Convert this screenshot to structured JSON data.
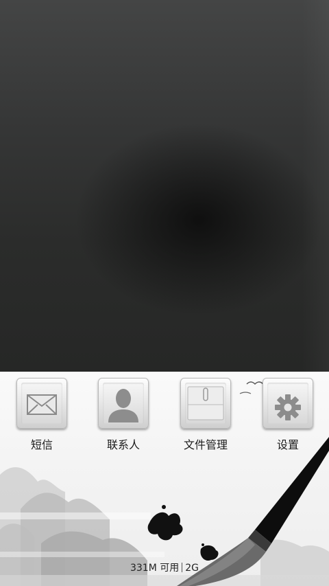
{
  "apps": [
    {
      "id": "sms",
      "label": "短信",
      "icon": "envelope-icon"
    },
    {
      "id": "contacts",
      "label": "联系人",
      "icon": "person-silhouette-icon"
    },
    {
      "id": "files",
      "label": "文件管理",
      "icon": "folder-clip-icon"
    },
    {
      "id": "settings",
      "label": "设置",
      "icon": "gear-icon"
    }
  ],
  "status": {
    "memory": "331M 可用",
    "network": "2G"
  },
  "colors": {
    "top_background": "#2b2c2b",
    "panel_background": "#f4f4f4",
    "label_text": "#1a1a1a"
  }
}
